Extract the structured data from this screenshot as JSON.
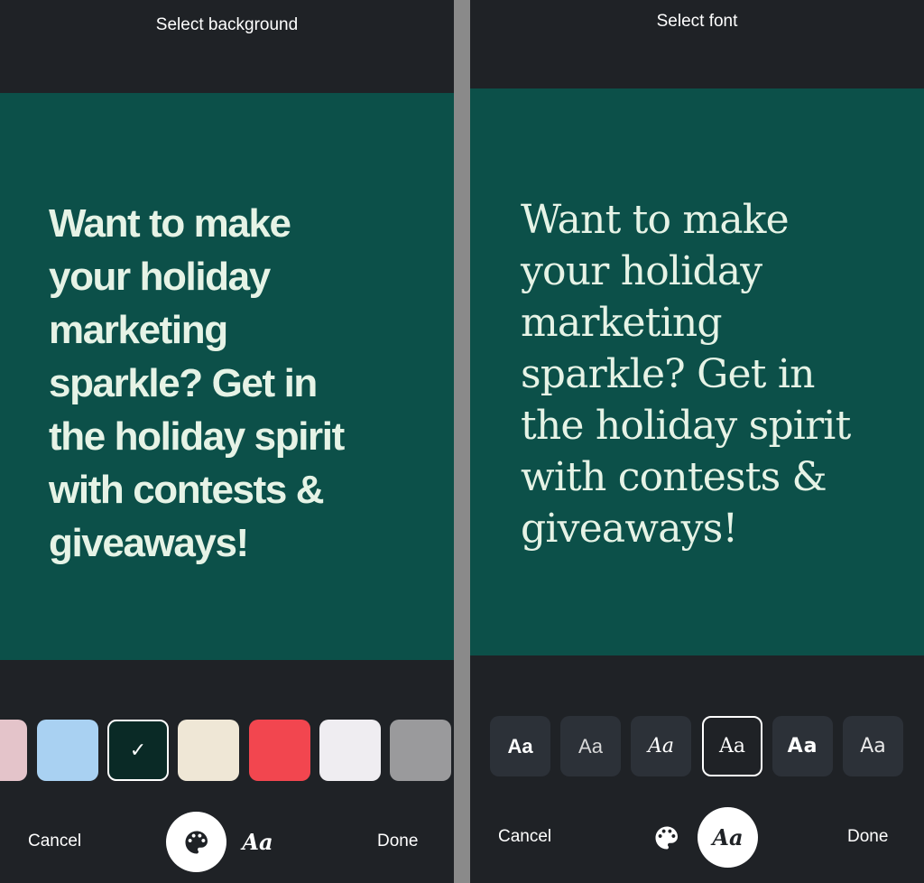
{
  "left_panel": {
    "title": "Select background",
    "post_text": "Want to make\nyour holiday\nmarketing\nsparkle? Get in\nthe holiday spirit\nwith contests &\ngiveaways!",
    "canvas_color": "#0c5049",
    "swatches": [
      {
        "color": "#e4c4ca"
      },
      {
        "color": "#a9d1f2"
      },
      {
        "color": "#0a2a26",
        "selected": true
      },
      {
        "color": "#efe7d6"
      },
      {
        "color": "#f2464f"
      },
      {
        "color": "#efedf1"
      },
      {
        "color": "#9a9a9c"
      }
    ],
    "check_glyph": "✓",
    "bottom": {
      "cancel_label": "Cancel",
      "font_tool_label": "Aa",
      "done_label": "Done",
      "active_tool": "palette-icon"
    }
  },
  "right_panel": {
    "title": "Select font",
    "post_text": "Want to make\nyour holiday\nmarketing\nsparkle? Get in\nthe holiday spirit\nwith contests &\ngiveaways!",
    "canvas_color": "#0c5049",
    "font_options": [
      {
        "label": "Aa",
        "style": "bold-sans"
      },
      {
        "label": "Aa",
        "style": "light-sans"
      },
      {
        "label": "Aa",
        "style": "script"
      },
      {
        "label": "Aa",
        "style": "serif",
        "selected": true
      },
      {
        "label": "Aa",
        "style": "wide-sans"
      },
      {
        "label": "Aa",
        "style": "rounded-sans"
      }
    ],
    "bottom": {
      "cancel_label": "Cancel",
      "font_tool_label": "Aa",
      "done_label": "Done",
      "active_tool": "font-tool"
    }
  }
}
